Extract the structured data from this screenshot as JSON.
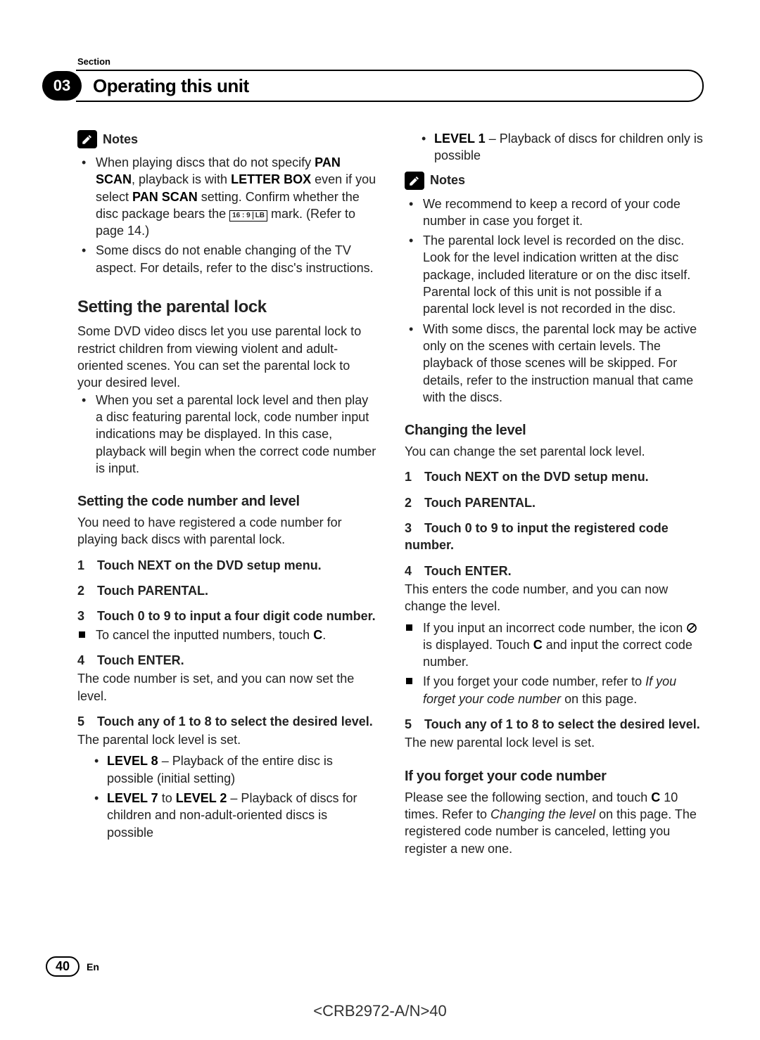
{
  "header": {
    "section_label": "Section",
    "number": "03",
    "title": "Operating this unit"
  },
  "leftCol": {
    "notes_label": "Notes",
    "note1_a": "When playing discs that do not specify ",
    "note1_b": "PAN SCAN",
    "note1_c": ", playback is with ",
    "note1_d": "LETTER BOX",
    "note1_e": " even if you select ",
    "note1_f": "PAN SCAN",
    "note1_g": " setting. Confirm whether the disc package bears the ",
    "note1_mark_a": "16 : 9",
    "note1_mark_b": "LB",
    "note1_h": " mark. (Refer to page 14.)",
    "note2": "Some discs do not enable changing of the TV aspect. For details, refer to the disc's instructions.",
    "h_parental": "Setting the parental lock",
    "parental_intro": "Some DVD video discs let you use parental lock to restrict children from viewing violent and adult-oriented scenes. You can set the parental lock to your desired level.",
    "parental_bullet": "When you set a parental lock level and then play a disc featuring parental lock, code number input indications may be displayed. In this case, playback will begin when the correct code number is input.",
    "h_setcode": "Setting the code number and level",
    "setcode_intro": "You need to have registered a code number for playing back discs with parental lock.",
    "step1": "1 Touch NEXT on the DVD setup menu.",
    "step2": "2 Touch PARENTAL.",
    "step3": "3 Touch 0 to 9 to input a four digit code number.",
    "step3_sq_a": "To cancel the inputted numbers, touch ",
    "step3_sq_b": "C",
    "step3_sq_c": ".",
    "step4": "4 Touch ENTER.",
    "step4_body": "The code number is set, and you can now set the level.",
    "step5": "5 Touch any of 1 to 8 to select the desired level.",
    "step5_body": "The parental lock level is set.",
    "lvl8_a": "LEVEL 8",
    "lvl8_b": " – Playback of the entire disc is possible (initial setting)",
    "lvl72_a": "LEVEL 7",
    "lvl72_b": " to ",
    "lvl72_c": "LEVEL 2",
    "lvl72_d": " – Playback of discs for children and non-adult-oriented discs is possible"
  },
  "rightCol": {
    "lvl1_a": "LEVEL 1",
    "lvl1_b": " – Playback of discs for children only is possible",
    "notes_label": "Notes",
    "rnote1": "We recommend to keep a record of your code number in case you forget it.",
    "rnote2": "The parental lock level is recorded on the disc. Look for the level indication written at the disc package, included literature or on the disc itself. Parental lock of this unit is not possible if a parental lock level is not recorded in the disc.",
    "rnote3": "With some discs, the parental lock may be active only on the scenes with certain levels. The playback of those scenes will be skipped. For details, refer to the instruction manual that came with the discs.",
    "h_change": "Changing the level",
    "change_intro": "You can change the set parental lock level.",
    "cstep1": "1 Touch NEXT on the DVD setup menu.",
    "cstep2": "2 Touch PARENTAL.",
    "cstep3": "3 Touch 0 to 9 to input the registered code number.",
    "cstep4": "4 Touch ENTER.",
    "cstep4_body": "This enters the code number, and you can now change the level.",
    "csq1_a": "If you input an incorrect code number, the icon ",
    "csq1_b": " is displayed. Touch ",
    "csq1_c": "C",
    "csq1_d": " and input the correct code number.",
    "csq2_a": "If you forget your code number, refer to ",
    "csq2_b": "If you forget your code number",
    "csq2_c": " on this page.",
    "cstep5": "5 Touch any of 1 to 8 to select the desired level.",
    "cstep5_body": "The new parental lock level is set.",
    "h_forgot": "If you forget your code number",
    "forgot_a": "Please see the following section, and touch ",
    "forgot_b": "C",
    "forgot_c": " 10 times. Refer to ",
    "forgot_d": "Changing the level",
    "forgot_e": " on this page. The registered code number is canceled, letting you register a new one."
  },
  "footer": {
    "page": "40",
    "lang": "En",
    "doc_code": "<CRB2972-A/N>40"
  }
}
